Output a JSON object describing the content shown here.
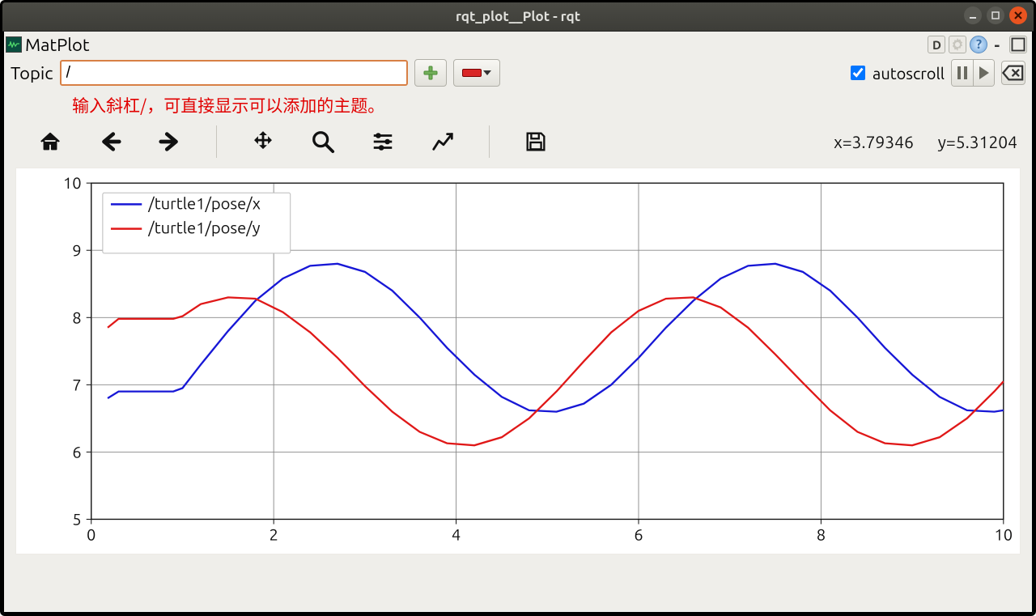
{
  "window": {
    "title": "rqt_plot__Plot - rqt"
  },
  "header": {
    "app_name": "MatPlot",
    "dock_label": "D",
    "help_label": "?"
  },
  "topicbar": {
    "label": "Topic",
    "value": "/",
    "autoscroll_label": "autoscroll",
    "autoscroll_checked": true
  },
  "annotation": "输入斜杠/，可直接显示可以添加的主题。",
  "mpl": {
    "coord_x_label": "x=3.79346",
    "coord_y_label": "y=5.31204"
  },
  "chart_data": {
    "type": "line",
    "xlim": [
      0,
      10
    ],
    "ylim": [
      5,
      10
    ],
    "xticks": [
      0,
      2,
      4,
      6,
      8,
      10
    ],
    "yticks": [
      5,
      6,
      7,
      8,
      9,
      10
    ],
    "legend_pos": "upper-left",
    "series": [
      {
        "name": "/turtle1/pose/x",
        "color": "#1717d6",
        "x": [
          0.18,
          0.3,
          0.9,
          1.0,
          1.2,
          1.5,
          1.8,
          2.1,
          2.4,
          2.7,
          3.0,
          3.3,
          3.6,
          3.9,
          4.2,
          4.5,
          4.8,
          5.1,
          5.4,
          5.7,
          6.0,
          6.3,
          6.6,
          6.9,
          7.2,
          7.5,
          7.8,
          8.1,
          8.4,
          8.7,
          9.0,
          9.3,
          9.6,
          9.9,
          10.0
        ],
        "y": [
          6.8,
          6.9,
          6.9,
          6.95,
          7.3,
          7.8,
          8.25,
          8.58,
          8.77,
          8.8,
          8.68,
          8.4,
          8.0,
          7.55,
          7.15,
          6.82,
          6.62,
          6.6,
          6.72,
          7.0,
          7.4,
          7.85,
          8.25,
          8.58,
          8.77,
          8.8,
          8.68,
          8.4,
          8.0,
          7.55,
          7.15,
          6.82,
          6.62,
          6.6,
          6.62
        ]
      },
      {
        "name": "/turtle1/pose/y",
        "color": "#e01818",
        "x": [
          0.18,
          0.3,
          0.9,
          1.0,
          1.2,
          1.5,
          1.8,
          2.1,
          2.4,
          2.7,
          3.0,
          3.3,
          3.6,
          3.9,
          4.2,
          4.5,
          4.8,
          5.1,
          5.4,
          5.7,
          6.0,
          6.3,
          6.6,
          6.9,
          7.2,
          7.5,
          7.8,
          8.1,
          8.4,
          8.7,
          9.0,
          9.3,
          9.6,
          9.9,
          10.0
        ],
        "y": [
          7.85,
          7.98,
          7.98,
          8.02,
          8.2,
          8.3,
          8.28,
          8.08,
          7.78,
          7.4,
          6.98,
          6.6,
          6.3,
          6.13,
          6.1,
          6.22,
          6.5,
          6.9,
          7.35,
          7.78,
          8.1,
          8.28,
          8.3,
          8.15,
          7.85,
          7.45,
          7.03,
          6.62,
          6.3,
          6.13,
          6.1,
          6.22,
          6.5,
          6.9,
          7.05
        ]
      }
    ]
  }
}
